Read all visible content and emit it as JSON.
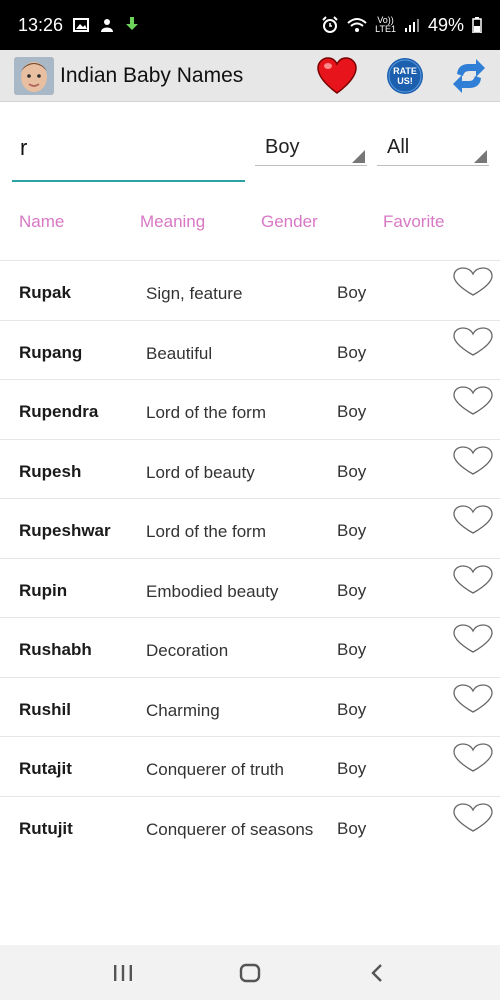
{
  "status_bar": {
    "time": "13:26",
    "network_top": "Vo))",
    "network_bottom": "LTE1",
    "battery": "49%"
  },
  "app_bar": {
    "title": "Indian Baby Names",
    "rate_label_1": "RATE",
    "rate_label_2": "US!"
  },
  "filters": {
    "search_value": "r",
    "gender_selected": "Boy",
    "category_selected": "All"
  },
  "columns": {
    "name": "Name",
    "meaning": "Meaning",
    "gender": "Gender",
    "favorite": "Favorite"
  },
  "rows": [
    {
      "name": "Rupak",
      "meaning": "Sign, feature",
      "gender": "Boy"
    },
    {
      "name": "Rupang",
      "meaning": "Beautiful",
      "gender": "Boy"
    },
    {
      "name": "Rupendra",
      "meaning": "Lord of the form",
      "gender": "Boy"
    },
    {
      "name": "Rupesh",
      "meaning": "Lord of beauty",
      "gender": "Boy"
    },
    {
      "name": "Rupeshwar",
      "meaning": "Lord of the form",
      "gender": "Boy"
    },
    {
      "name": "Rupin",
      "meaning": "Embodied beauty",
      "gender": "Boy"
    },
    {
      "name": "Rushabh",
      "meaning": "Decoration",
      "gender": "Boy"
    },
    {
      "name": "Rushil",
      "meaning": "Charming",
      "gender": "Boy"
    },
    {
      "name": "Rutajit",
      "meaning": "Conquerer of truth",
      "gender": "Boy"
    },
    {
      "name": "Rutujit",
      "meaning": "Conquerer of seasons",
      "gender": "Boy"
    }
  ],
  "colors": {
    "header_text": "#d878c4",
    "search_underline": "#29a3a3",
    "heart_red": "#e8141b",
    "rate_blue": "#1b5fae",
    "refresh_blue": "#2f7fd6"
  },
  "icons": {
    "favorites": "heart-icon",
    "rate": "rate-us-icon",
    "refresh": "refresh-icon",
    "favorite_toggle": "heart-outline-icon"
  }
}
